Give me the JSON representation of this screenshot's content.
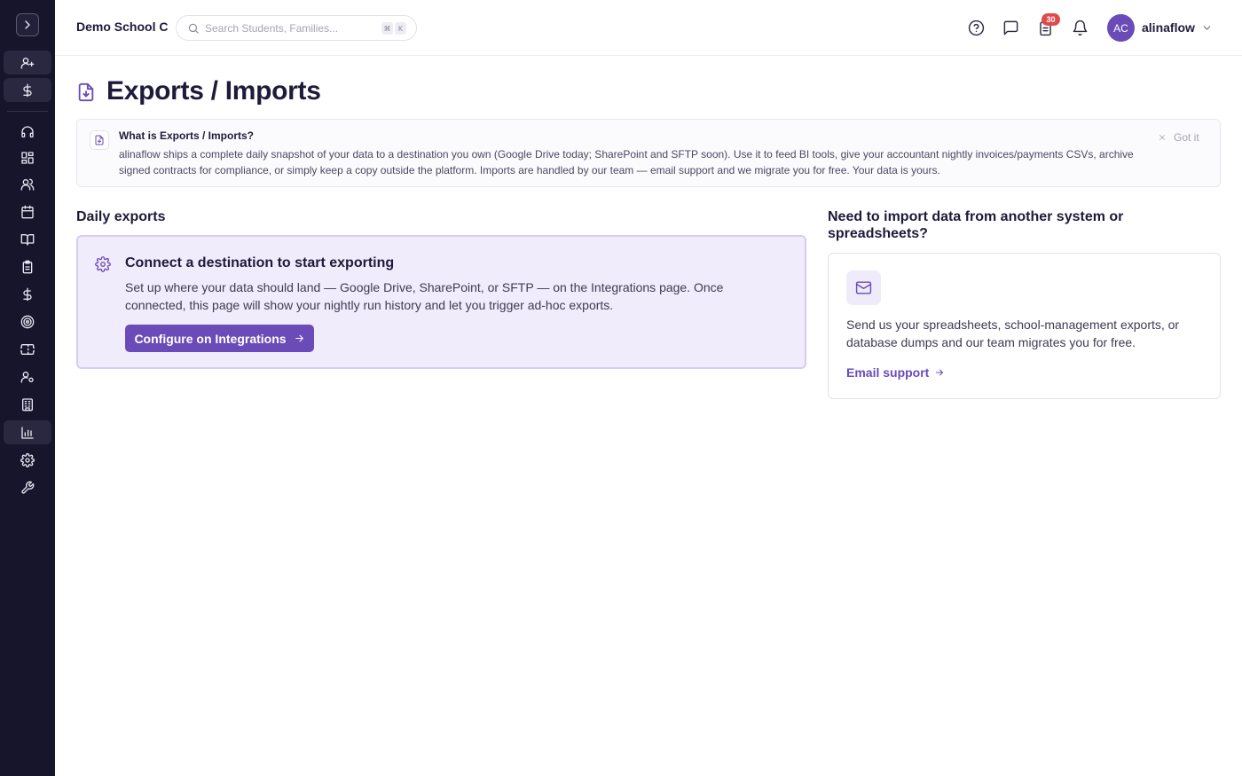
{
  "header": {
    "school_name": "Demo School C",
    "search_placeholder": "Search Students, Families...",
    "shortcut_keys": [
      "⌘",
      "K"
    ],
    "notification_badge": "30",
    "avatar_initials": "AC",
    "username": "alinaflow"
  },
  "sidebar": {
    "items": [
      {
        "icon": "user-plus-icon"
      },
      {
        "icon": "dollar-icon"
      },
      {
        "icon": "headset-icon"
      },
      {
        "icon": "dashboard-grid-icon"
      },
      {
        "icon": "users-icon"
      },
      {
        "icon": "calendar-icon"
      },
      {
        "icon": "book-open-icon"
      },
      {
        "icon": "clipboard-icon"
      },
      {
        "icon": "dollar-icon"
      },
      {
        "icon": "target-icon"
      },
      {
        "icon": "ticket-icon"
      },
      {
        "icon": "user-gear-icon"
      },
      {
        "icon": "building-icon"
      },
      {
        "icon": "bar-chart-icon"
      },
      {
        "icon": "gear-icon"
      },
      {
        "icon": "wrench-icon"
      }
    ],
    "active_icon": "bar-chart-icon"
  },
  "page": {
    "title": "Exports / Imports"
  },
  "info_banner": {
    "title": "What is Exports / Imports?",
    "text": "alinaflow ships a complete daily snapshot of your data to a destination you own (Google Drive today; SharePoint and SFTP soon). Use it to feed BI tools, give your accountant nightly invoices/payments CSVs, archive signed contracts for compliance, or simply keep a copy outside the platform. Imports are handled by our team — email support and we migrate you for free. Your data is yours.",
    "dismiss_label": "Got it"
  },
  "daily_exports": {
    "heading": "Daily exports",
    "card_title": "Connect a destination to start exporting",
    "card_text": "Set up where your data should land — Google Drive, SharePoint, or SFTP — on the Integrations page. Once connected, this page will show your nightly run history and let you trigger ad-hoc exports.",
    "button_label": "Configure on Integrations"
  },
  "import_section": {
    "heading": "Need to import data from another system or spreadsheets?",
    "text": "Send us your spreadsheets, school-management exports, or database dumps and our team migrates you for free.",
    "link_label": "Email support"
  },
  "colors": {
    "accent": "#6a4bb8",
    "sidebar_bg": "#17152b",
    "badge": "#e14a4a",
    "callout_bg": "#f1ecfb"
  }
}
